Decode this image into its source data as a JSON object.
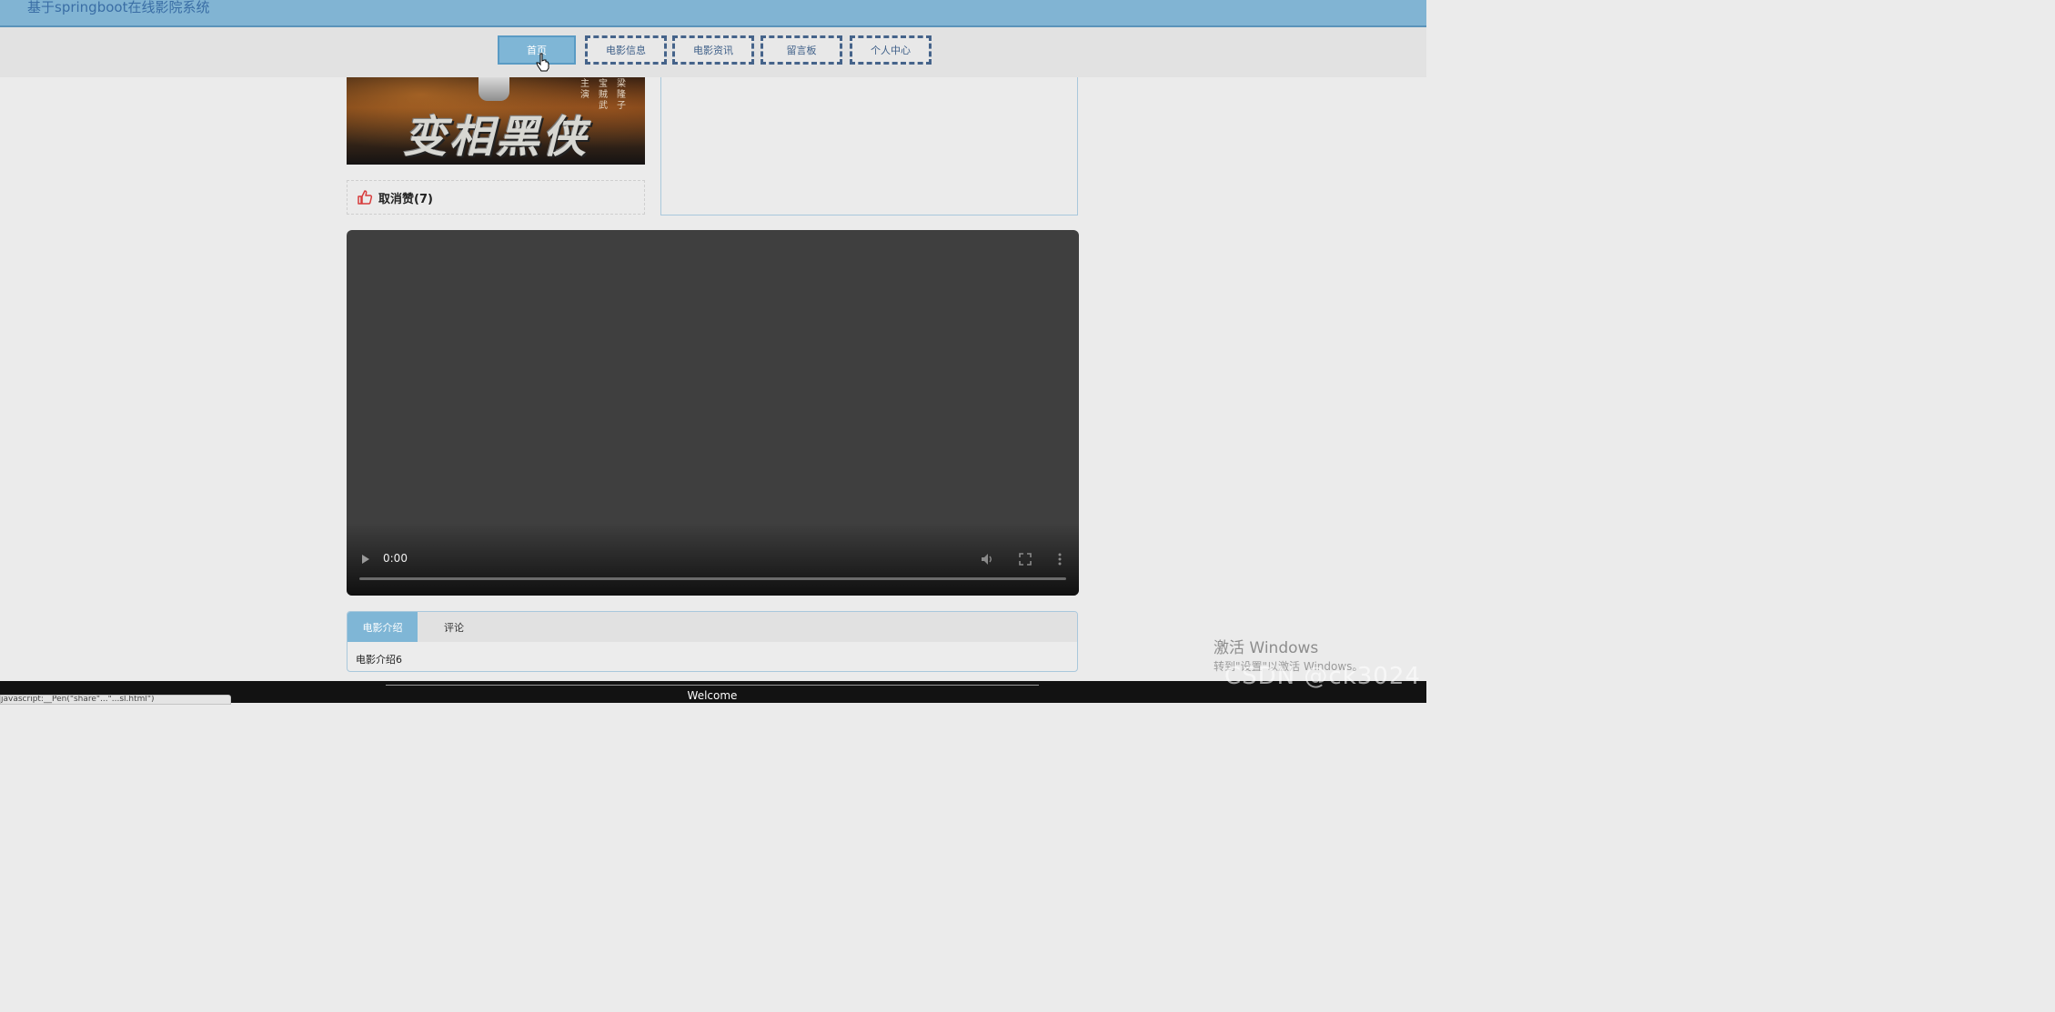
{
  "header": {
    "site_title": "基于springboot在线影院系统"
  },
  "nav": {
    "items": [
      {
        "label": "首页",
        "active": true
      },
      {
        "label": "电影信息",
        "active": false
      },
      {
        "label": "电影资讯",
        "active": false
      },
      {
        "label": "留言板",
        "active": false
      },
      {
        "label": "个人中心",
        "active": false
      }
    ]
  },
  "poster": {
    "title": "变相黑侠",
    "credits_left": "主演",
    "credits_mid": "宝贼武",
    "credits_right": "梁隆子"
  },
  "like": {
    "label": "取消赞(7)",
    "icon": "thumbs-up-icon"
  },
  "video": {
    "time": "0:00",
    "progress": 0
  },
  "tabs": {
    "items": [
      "电影介绍",
      "评论"
    ],
    "active_index": 0,
    "content": "电影介绍6"
  },
  "footer": {
    "text": "Welcome"
  },
  "watermark": {
    "line1": "激活 Windows",
    "line2": "转到\"设置\"以激活 Windows。",
    "csdn": "CSDN @ck3024"
  },
  "status_bar": {
    "text": "javascript:__Pen(\"share\"...\"...sl.html\")"
  },
  "colors": {
    "topbar": "#81b4d3",
    "accent": "#7fb6d6",
    "nav_border": "#45638a",
    "footer": "#121212"
  }
}
